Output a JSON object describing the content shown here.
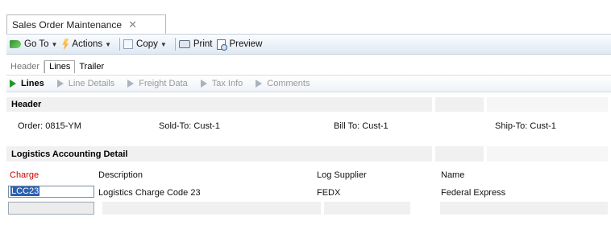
{
  "document_tab": {
    "title": "Sales Order Maintenance",
    "close": "✕"
  },
  "toolbar": {
    "goto_label": "Go To",
    "actions_label": "Actions",
    "copy_label": "Copy",
    "print_label": "Print",
    "preview_label": "Preview"
  },
  "sub_tabs": [
    "Header",
    "Lines",
    "Trailer"
  ],
  "section_nav": [
    "Lines",
    "Line Details",
    "Freight Data",
    "Tax Info",
    "Comments"
  ],
  "header_section": {
    "title": "Header",
    "order": "Order: 0815-YM",
    "sold_to": "Sold-To: Cust-1",
    "bill_to": "Bill To: Cust-1",
    "ship_to": "Ship-To: Cust-1"
  },
  "logistics_section": {
    "title": "Logistics Accounting Detail",
    "columns": {
      "charge": "Charge",
      "description": "Description",
      "log_supplier": "Log Supplier",
      "name": "Name"
    },
    "row": {
      "charge": "LCC23",
      "description": "Logistics Charge Code 23",
      "log_supplier": "FEDX",
      "name": "Federal Express"
    }
  },
  "colors": {
    "charge_label": "#cc0000",
    "active_nav": "#1c9a1c",
    "selection": "#2b5fb3"
  }
}
